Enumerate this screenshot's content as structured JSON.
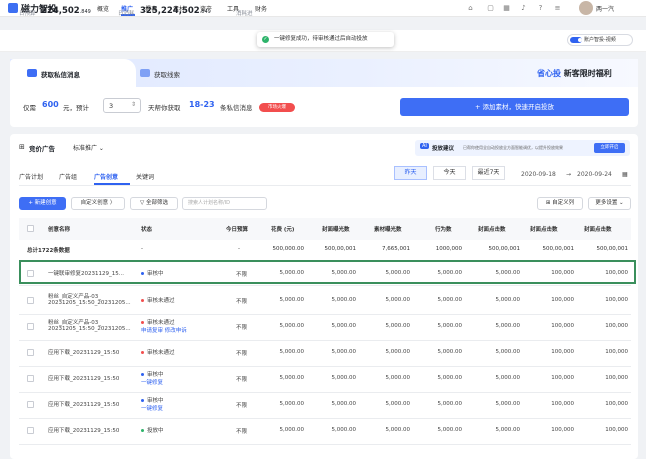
{
  "app": {
    "name": "磁力智投"
  },
  "nav": [
    "概览",
    "推广",
    "报表",
    "素材",
    "资产",
    "工具",
    "财务"
  ],
  "user": {
    "name": "两一汽"
  },
  "stats": [
    {
      "label": "日预算",
      "value": "224,502",
      "suffix": ".849"
    },
    {
      "label": "日消耗",
      "value": "325,224,502",
      "suffix": ".849"
    },
    {
      "label": "消耗进",
      "value": "",
      "suffix": ""
    }
  ],
  "toast": "一键修复成功，待审核通过后自动投放",
  "smart_toggle": {
    "label": "账户智投-视频"
  },
  "acquire": {
    "tabs": [
      "获取私信消息",
      "获取线索"
    ],
    "promo_prefix": "省心投",
    "promo_suffix": "新客限时福利",
    "text": {
      "a": "仅需",
      "amount": "600",
      "b": "元，预计",
      "c": "天帮你获取",
      "range": "18-23",
      "d": "条私信消息"
    },
    "days": "3",
    "badge": "市场火爆",
    "button": "+ 添加素材，快速开启投放"
  },
  "ads": {
    "title": "竞价广告",
    "mode": "标准推广",
    "suggest_label": "投放建议",
    "suggest_text": "已帮你使用全自动投放全方面智能调优，以提升投放效果",
    "suggest_btn": "立即开启",
    "tabs": [
      "广告计划",
      "广告组",
      "广告创意",
      "关键词"
    ],
    "date_seg": [
      "昨天",
      "今天",
      "最近7天"
    ],
    "date_start": "2020-09-18",
    "date_arrow": "→",
    "date_end": "2020-09-24",
    "toolbar": {
      "create": "+ 新建创意",
      "custom_creative": "自定义创意 〉",
      "filter": "▽ 全部筛选",
      "search_ph": "搜索人计划名称/ID",
      "custom_cols": "自定义列",
      "more": "更多设置 ⌄"
    },
    "columns": [
      "创意名称",
      "状态",
      "今日预算",
      "花费 (元)",
      "封面曝光数",
      "素材曝光数",
      "行为数",
      "封面点击数",
      "封面点击数",
      "封面点击数"
    ],
    "totals": {
      "label": "总计1722条数据",
      "status": "-",
      "budget": "-",
      "v1": "500,000.00",
      "v2": "500,00,001",
      "v3": "7,665,001",
      "v4": "1000,000",
      "v5": "500,00,001",
      "v6": "500,00,001",
      "v7": "500,00,001"
    },
    "rows": [
      {
        "name": [
          "一键联审修复20231129_15..."
        ],
        "status": [
          {
            "text": "审核中",
            "color": "#2f62f0"
          }
        ],
        "budget": "不限",
        "v1": "5,000.00",
        "v2": "5,000.00",
        "v3": "5,000.00",
        "v4": "5,000.00",
        "v5": "5,000.00",
        "v6": "100,000",
        "v7": "100,000"
      },
      {
        "name": [
          "粉丝_自定义产品-03_",
          "20231205_15:50_20231205..."
        ],
        "status": [
          {
            "text": "审核未通过",
            "color": "#f24e4e"
          }
        ],
        "budget": "不限",
        "v1": "5,000.00",
        "v2": "5,000.00",
        "v3": "5,000.00",
        "v4": "5,000.00",
        "v5": "5,000.00",
        "v6": "100,000",
        "v7": "100,000"
      },
      {
        "name": [
          "粉丝_自定义产品-03_",
          "20231205_15:50_20231205..."
        ],
        "status": [
          {
            "text": "审核未通过",
            "color": "#f24e4e"
          },
          {
            "text": "申请复审  修改申诉",
            "link": true
          }
        ],
        "budget": "不限",
        "v1": "5,000.00",
        "v2": "5,000.00",
        "v3": "5,000.00",
        "v4": "5,000.00",
        "v5": "5,000.00",
        "v6": "100,000",
        "v7": "100,000"
      },
      {
        "name": [
          "应用下载_20231129_15:50"
        ],
        "status": [
          {
            "text": "审核未通过",
            "color": "#f24e4e"
          }
        ],
        "budget": "不限",
        "v1": "5,000.00",
        "v2": "5,000.00",
        "v3": "5,000.00",
        "v4": "5,000.00",
        "v5": "5,000.00",
        "v6": "100,000",
        "v7": "100,000"
      },
      {
        "name": [
          "应用下载_20231129_15:50"
        ],
        "status": [
          {
            "text": "审核中",
            "color": "#2f62f0"
          },
          {
            "text": "一键修复",
            "link": true
          }
        ],
        "budget": "不限",
        "v1": "5,000.00",
        "v2": "5,000.00",
        "v3": "5,000.00",
        "v4": "5,000.00",
        "v5": "5,000.00",
        "v6": "100,000",
        "v7": "100,000"
      },
      {
        "name": [
          "应用下载_20231129_15:50"
        ],
        "status": [
          {
            "text": "审核中",
            "color": "#2f62f0"
          },
          {
            "text": "一键修复",
            "link": true
          }
        ],
        "budget": "不限",
        "v1": "5,000.00",
        "v2": "5,000.00",
        "v3": "5,000.00",
        "v4": "5,000.00",
        "v5": "5,000.00",
        "v6": "100,000",
        "v7": "100,000"
      },
      {
        "name": [
          "应用下载_20231129_15:50"
        ],
        "status": [
          {
            "text": "投放中",
            "color": "#2db36a"
          }
        ],
        "budget": "不限",
        "v1": "5,000.00",
        "v2": "5,000.00",
        "v3": "5,000.00",
        "v4": "5,000.00",
        "v5": "5,000.00",
        "v6": "100,000",
        "v7": "100,000"
      }
    ]
  },
  "colors": {
    "primary": "#2f62f0",
    "danger": "#f24e4e",
    "success": "#2db36a",
    "highlight": "#3a8f5c"
  }
}
